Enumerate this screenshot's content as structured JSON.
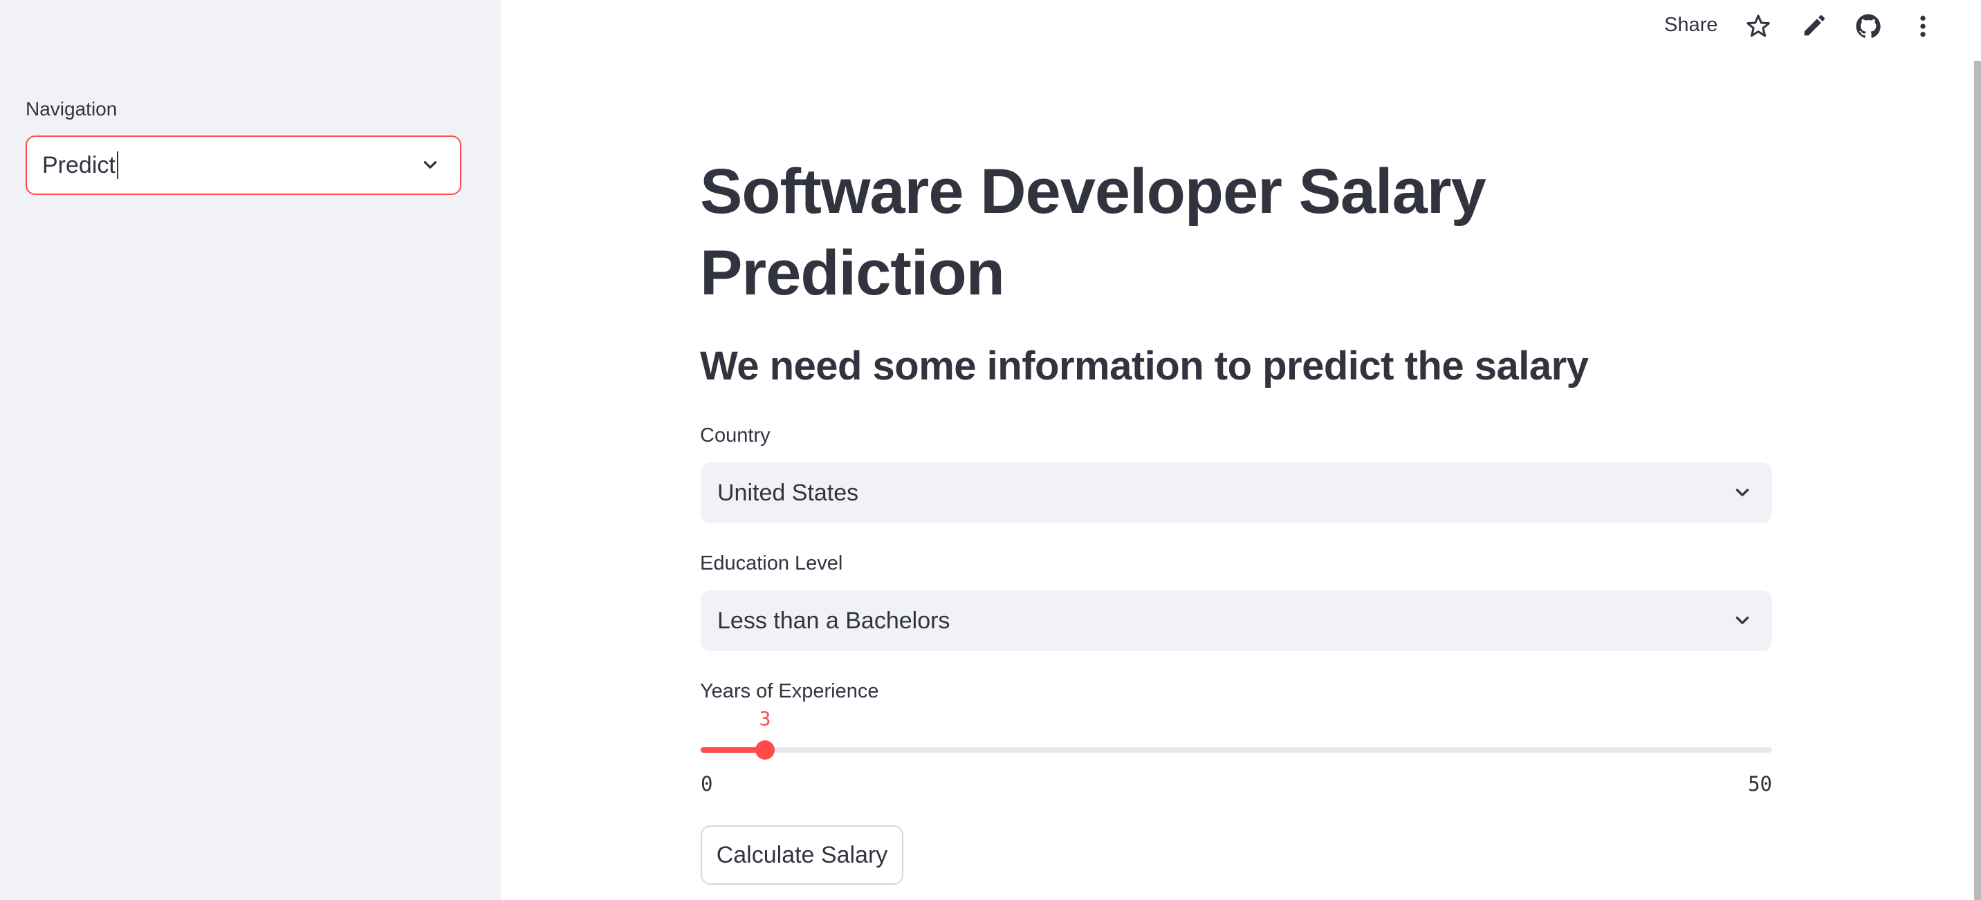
{
  "sidebar": {
    "navigation_label": "Navigation",
    "navigation_value": "Predict"
  },
  "header": {
    "share_label": "Share",
    "icons": [
      "star-icon",
      "pencil-icon",
      "github-icon",
      "more-vert-icon"
    ]
  },
  "main": {
    "title": "Software Developer Salary Prediction",
    "subtitle": "We need some information to predict the salary",
    "country": {
      "label": "Country",
      "value": "United States"
    },
    "education": {
      "label": "Education Level",
      "value": "Less than a Bachelors"
    },
    "experience": {
      "label": "Years of Experience",
      "value": "3",
      "min": "0",
      "max": "50"
    },
    "calculate_button": "Calculate Salary"
  },
  "colors": {
    "accent": "#ff4b4b",
    "sidebar_bg": "#f0f2f6",
    "text": "#31333f"
  }
}
